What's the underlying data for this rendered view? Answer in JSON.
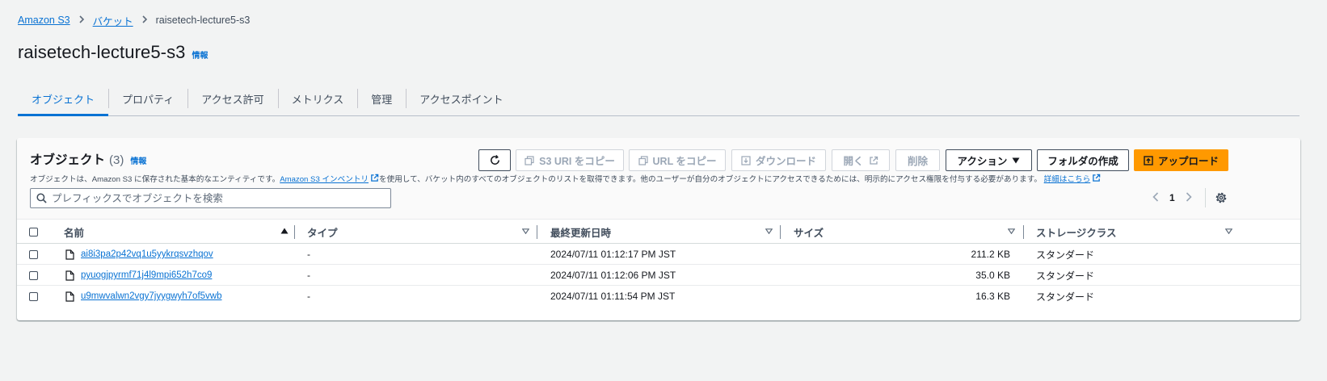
{
  "breadcrumb": {
    "items": [
      "Amazon S3",
      "バケット"
    ],
    "current": "raisetech-lecture5-s3"
  },
  "page": {
    "title": "raisetech-lecture5-s3",
    "info_label": "情報"
  },
  "tabs": [
    {
      "label": "オブジェクト",
      "active": true
    },
    {
      "label": "プロパティ"
    },
    {
      "label": "アクセス許可"
    },
    {
      "label": "メトリクス"
    },
    {
      "label": "管理"
    },
    {
      "label": "アクセスポイント"
    }
  ],
  "objects_panel": {
    "title": "オブジェクト",
    "count": "(3)",
    "info_label": "情報",
    "description_pre": "オブジェクトは、Amazon S3 に保存された基本的なエンティティです。",
    "description_link": "Amazon S3 インベントリ",
    "description_mid": "を使用して、バケット内のすべてのオブジェクトのリストを取得できます。他のユーザーが自分のオブジェクトにアクセスできるためには、明示的にアクセス権限を付与する必要があります。",
    "description_link2": "詳細はこちら"
  },
  "toolbar": {
    "copy_s3_uri": "S3 URI をコピー",
    "copy_url": "URL をコピー",
    "download": "ダウンロード",
    "open": "開く",
    "delete": "削除",
    "actions": "アクション",
    "create_folder": "フォルダの作成",
    "upload": "アップロード"
  },
  "search": {
    "placeholder": "プレフィックスでオブジェクトを検索",
    "value": ""
  },
  "pagination": {
    "current_page": "1"
  },
  "table": {
    "columns": [
      "名前",
      "タイプ",
      "最終更新日時",
      "サイズ",
      "ストレージクラス"
    ],
    "rows": [
      {
        "name": "ai8i3pa2p42vq1u5yykrqsvzhqov",
        "type": "-",
        "modified": "2024/07/11 01:12:17 PM JST",
        "size": "211.2 KB",
        "storage": "スタンダード"
      },
      {
        "name": "pyuogjpyrmf71j4l9mpi652h7co9",
        "type": "-",
        "modified": "2024/07/11 01:12:06 PM JST",
        "size": "35.0 KB",
        "storage": "スタンダード"
      },
      {
        "name": "u9mwvalwn2vgy7jyygwyh7of5vwb",
        "type": "-",
        "modified": "2024/07/11 01:11:54 PM JST",
        "size": "16.3 KB",
        "storage": "スタンダード"
      }
    ]
  },
  "colors": {
    "link": "#0972d3",
    "primary_button": "#ff9900",
    "background": "#f2f3f3"
  }
}
